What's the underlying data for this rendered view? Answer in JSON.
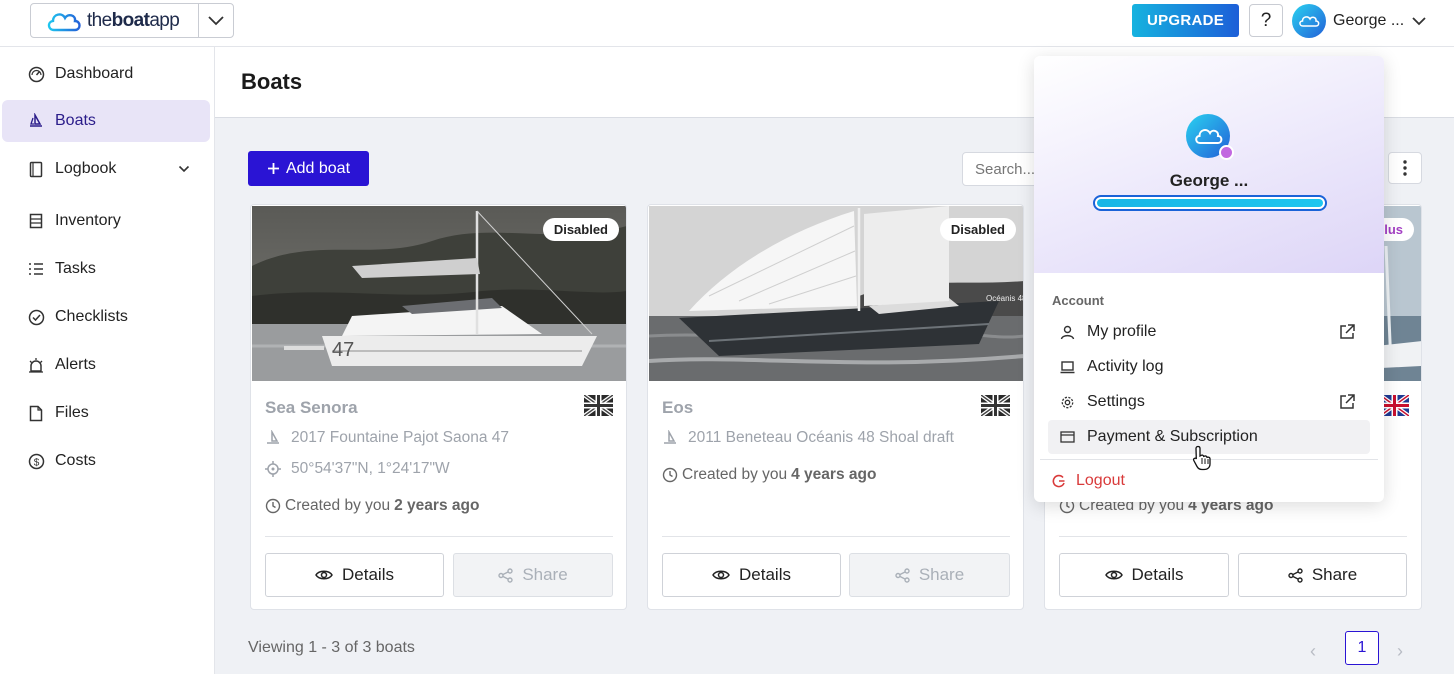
{
  "app": {
    "logo_prefix": "the",
    "logo_bold": "boat",
    "logo_suffix": "app",
    "logo_icon": "cloud-logo-icon"
  },
  "header": {
    "upgrade_label": "UPGRADE",
    "help_label": "?",
    "user_name": "George ...",
    "accent_gradient": [
      "#16b2df",
      "#1d5fd8"
    ]
  },
  "sidebar": {
    "items": [
      {
        "label": "Dashboard",
        "icon": "gauge-icon"
      },
      {
        "label": "Boats",
        "icon": "sailboat-icon",
        "active": true
      },
      {
        "label": "Logbook",
        "icon": "book-icon",
        "expandable": true
      },
      {
        "label": "Inventory",
        "icon": "inventory-icon"
      },
      {
        "label": "Tasks",
        "icon": "list-icon"
      },
      {
        "label": "Checklists",
        "icon": "check-circle-icon"
      },
      {
        "label": "Alerts",
        "icon": "alarm-icon"
      },
      {
        "label": "Files",
        "icon": "file-icon"
      },
      {
        "label": "Costs",
        "icon": "dollar-icon"
      }
    ],
    "active_color": "#e8e4f7"
  },
  "main": {
    "title": "Boats",
    "add_boat_label": "Add boat",
    "search_placeholder": "Search...",
    "primary_color": "#2a14d4"
  },
  "boats": [
    {
      "name": "Sea Senora",
      "badge": "Disabled",
      "model": "2017 Fountaine Pajot Saona 47",
      "location": "50°54'37\"N, 1°24'17\"W",
      "created_prefix": "Created by you",
      "created_when": "2 years ago",
      "details_label": "Details",
      "share_label": "Share",
      "share_disabled": true
    },
    {
      "name": "Eos",
      "badge": "Disabled",
      "model": "2011 Beneteau Océanis 48 Shoal draft",
      "created_prefix": "Created by you",
      "created_when": "4 years ago",
      "details_label": "Details",
      "share_label": "Share",
      "share_disabled": true
    },
    {
      "badge": "lus",
      "created_prefix": "Created by you",
      "created_when": "4 years ago",
      "details_label": "Details",
      "share_label": "Share",
      "share_disabled": false
    }
  ],
  "pagination": {
    "summary": "Viewing 1 - 3 of 3 boats",
    "current_page": "1",
    "prev_label": "‹",
    "next_label": "›"
  },
  "user_dropdown": {
    "name": "George ...",
    "progress": 1.0,
    "section_label": "Account",
    "items": [
      {
        "label": "My profile",
        "icon": "user-icon",
        "external": true
      },
      {
        "label": "Activity log",
        "icon": "laptop-icon",
        "external": false
      },
      {
        "label": "Settings",
        "icon": "gear-icon",
        "external": true
      },
      {
        "label": "Payment & Subscription",
        "icon": "credit-card-icon",
        "external": false,
        "hovered": true
      }
    ],
    "logout_label": "Logout",
    "logout_color": "#d93a3a"
  }
}
